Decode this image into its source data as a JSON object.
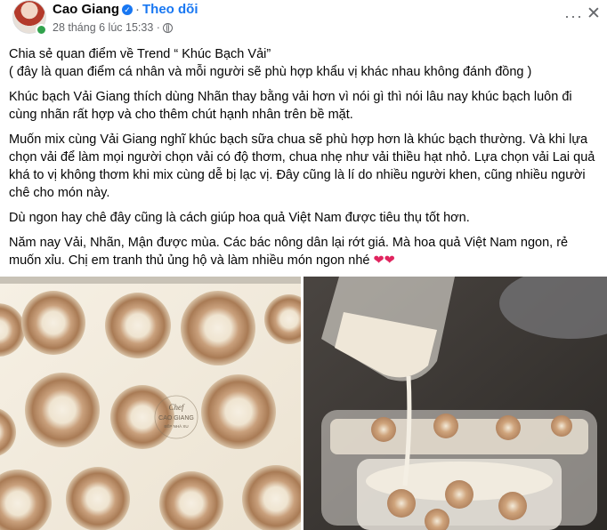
{
  "author": {
    "name": "Cao Giang",
    "separator": "·",
    "follow_label": "Theo dõi",
    "timestamp": "28 tháng 6 lúc 15:33 ·",
    "privacy_icon": "globe-icon"
  },
  "post": {
    "paragraphs": [
      "Chia sẻ quan điểm về Trend “ Khúc Bạch Vải”\n( đây là quan điểm cá nhân và mỗi người sẽ phù hợp khẩu vị khác nhau không đánh đồng )",
      "Khúc bạch Vải Giang thích dùng Nhãn thay bằng vải hơn vì nói gì thì nói lâu nay khúc bạch luôn đi cùng nhãn rất hợp và cho thêm chút hạnh nhân trên bề mặt.",
      "Muốn mix cùng Vải Giang nghĩ khúc bạch sữa chua sẽ phù hợp hơn là khúc bạch thường. Và khi lựa chọn vải để làm mọi người chọn vải có độ thơm, chua nhẹ như vải thiều hạt nhỏ. Lựa chọn vải Lai quả khá to vị không thơm khi mix cùng dễ bị lạc vị. Đây cũng là lí do nhiều người khen, cũng nhiều người chê cho món này.",
      "Dù ngon hay chê đây cũng là cách giúp hoa quả Việt Nam được tiêu thụ tốt hơn.",
      "Năm nay Vải, Nhãn, Mận được mùa. Các bác nông dân lại rớt giá. Mà hoa quả Việt Nam ngon, rẻ muốn xỉu. Chị em tranh thủ ủng hộ và làm nhiều món ngon nhé"
    ],
    "hearts": "❤❤"
  },
  "photos": {
    "watermark": {
      "line1": "Chef",
      "line2": "CAO GIANG",
      "line3": "BẾP NHÀ XU"
    }
  },
  "colors": {
    "accent": "#1877f2",
    "meta": "#65676b",
    "heart": "#e0245e"
  }
}
